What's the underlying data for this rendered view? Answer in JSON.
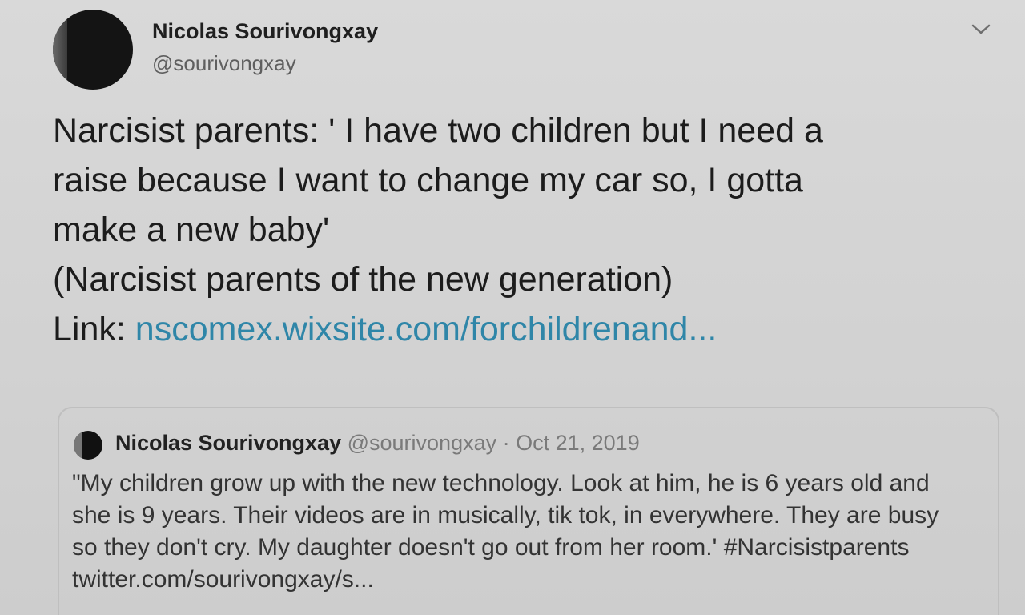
{
  "tweet": {
    "display_name": "Nicolas Sourivongxay",
    "handle": "@sourivongxay",
    "lines": [
      "Narcisist parents: ' I have two children but I need a",
      "raise because I want to change my car so, I gotta",
      "make a new baby'",
      "(Narcisist parents of the new generation)"
    ],
    "link_prefix": "Link: ",
    "link_text": "nscomex.wixsite.com/forchildrenand..."
  },
  "quoted_tweet": {
    "display_name": "Nicolas Sourivongxay",
    "handle": "@sourivongxay",
    "separator": " · ",
    "date": "Oct 21, 2019",
    "lines": [
      "\"My children grow up with the new technology. Look at him, he is 6 years old and",
      "she is 9 years. Their videos are in musically, tik tok, in everywhere. They are busy",
      "so they don't cry. My daughter doesn't go out from her room.' #Narcisistparents",
      "twitter.com/sourivongxay/s..."
    ]
  },
  "icons": {
    "menu": "chevron-down-icon"
  }
}
